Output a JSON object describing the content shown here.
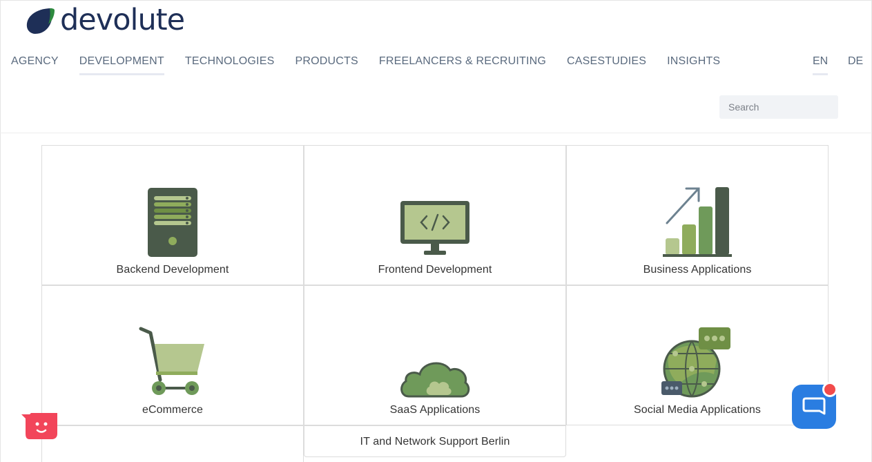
{
  "header": {
    "logo_text": "devolute",
    "nav": [
      "AGENCY",
      "DEVELOPMENT",
      "TECHNOLOGIES",
      "PRODUCTS",
      "FREELANCERS & RECRUITING",
      "CASESTUDIES",
      "INSIGHTS"
    ],
    "active_nav": "DEVELOPMENT",
    "lang_en": "EN",
    "lang_de": "DE",
    "search_placeholder": "Search"
  },
  "services": [
    {
      "label": "Backend Development",
      "icon": "server-icon"
    },
    {
      "label": "Frontend Development",
      "icon": "monitor-code-icon"
    },
    {
      "label": "Business Applications",
      "icon": "bar-chart-icon"
    },
    {
      "label": "eCommerce",
      "icon": "shopping-cart-icon"
    },
    {
      "label": "SaaS Applications",
      "icon": "cloud-icon"
    },
    {
      "label": "Social Media Applications",
      "icon": "globe-chat-icon"
    },
    {
      "label": "IT and Network Support Berlin",
      "icon": ""
    }
  ],
  "colors": {
    "brand_navy": "#1e2f57",
    "nav_text": "#5a6a7e",
    "icon_dark": "#4a5a4a",
    "icon_green": "#8fac5c",
    "icon_light": "#b5c78f",
    "chat_blue": "#2a7de1",
    "chat_red": "#f24b4b"
  }
}
